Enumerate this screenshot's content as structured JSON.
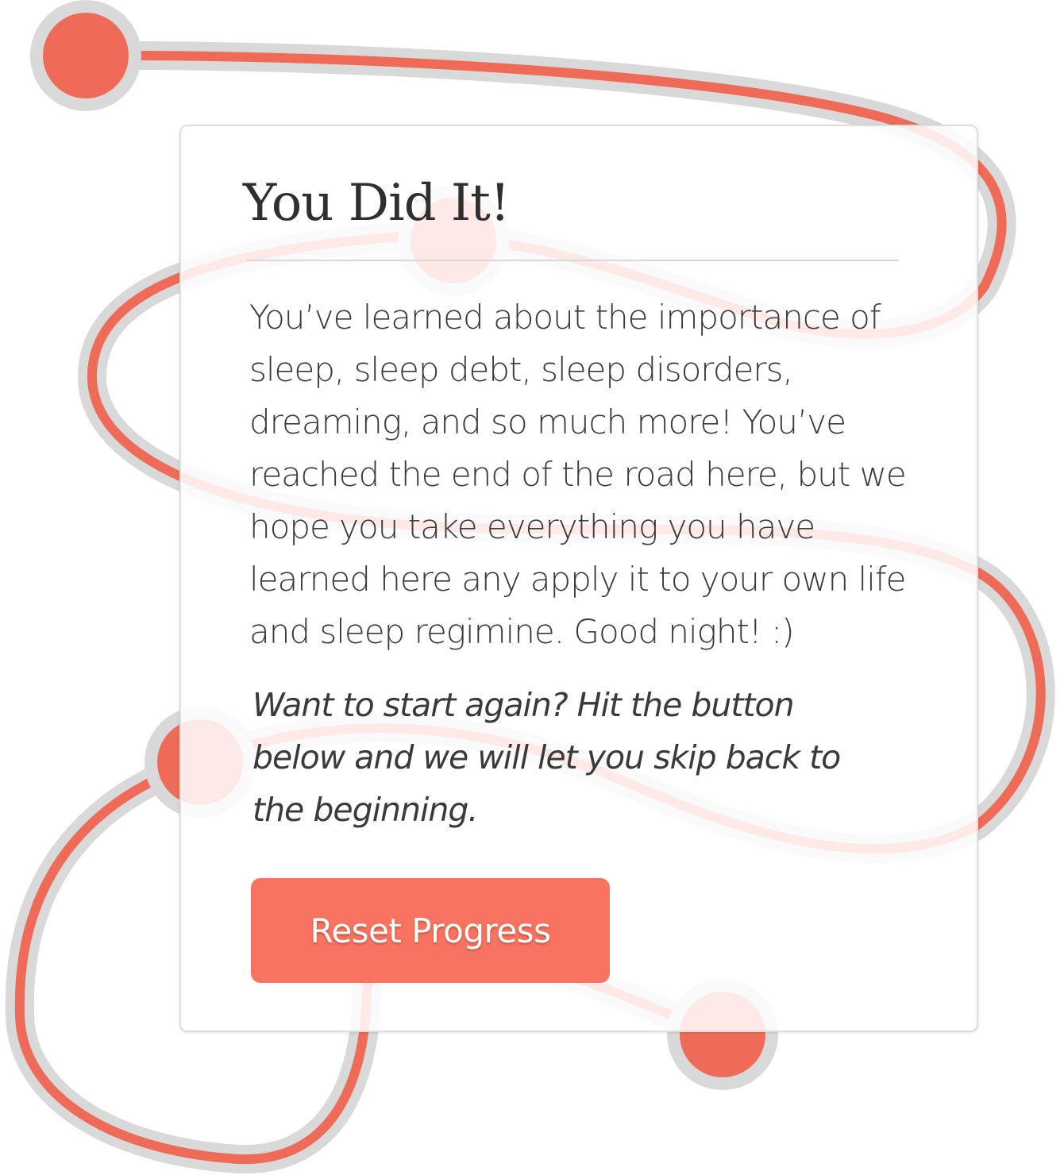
{
  "card": {
    "title": "You Did It!",
    "body": "You’ve learned about the importance of sleep, sleep debt, sleep disorders, dreaming, and so much more! You’ve reached the end of the road here, but we hope you take everything you have learned here any apply it to your own life and sleep regimine. Good night! :)",
    "note": "Want to start again? Hit the button below and we will let you skip back to the beginning.",
    "button_label": "Reset Progress"
  },
  "colors": {
    "road": "#ee6b57",
    "road_casing": "#d9d9d9",
    "button": "#f97460",
    "title_text": "#2f2f2f",
    "body_text": "#3a3a3a"
  }
}
